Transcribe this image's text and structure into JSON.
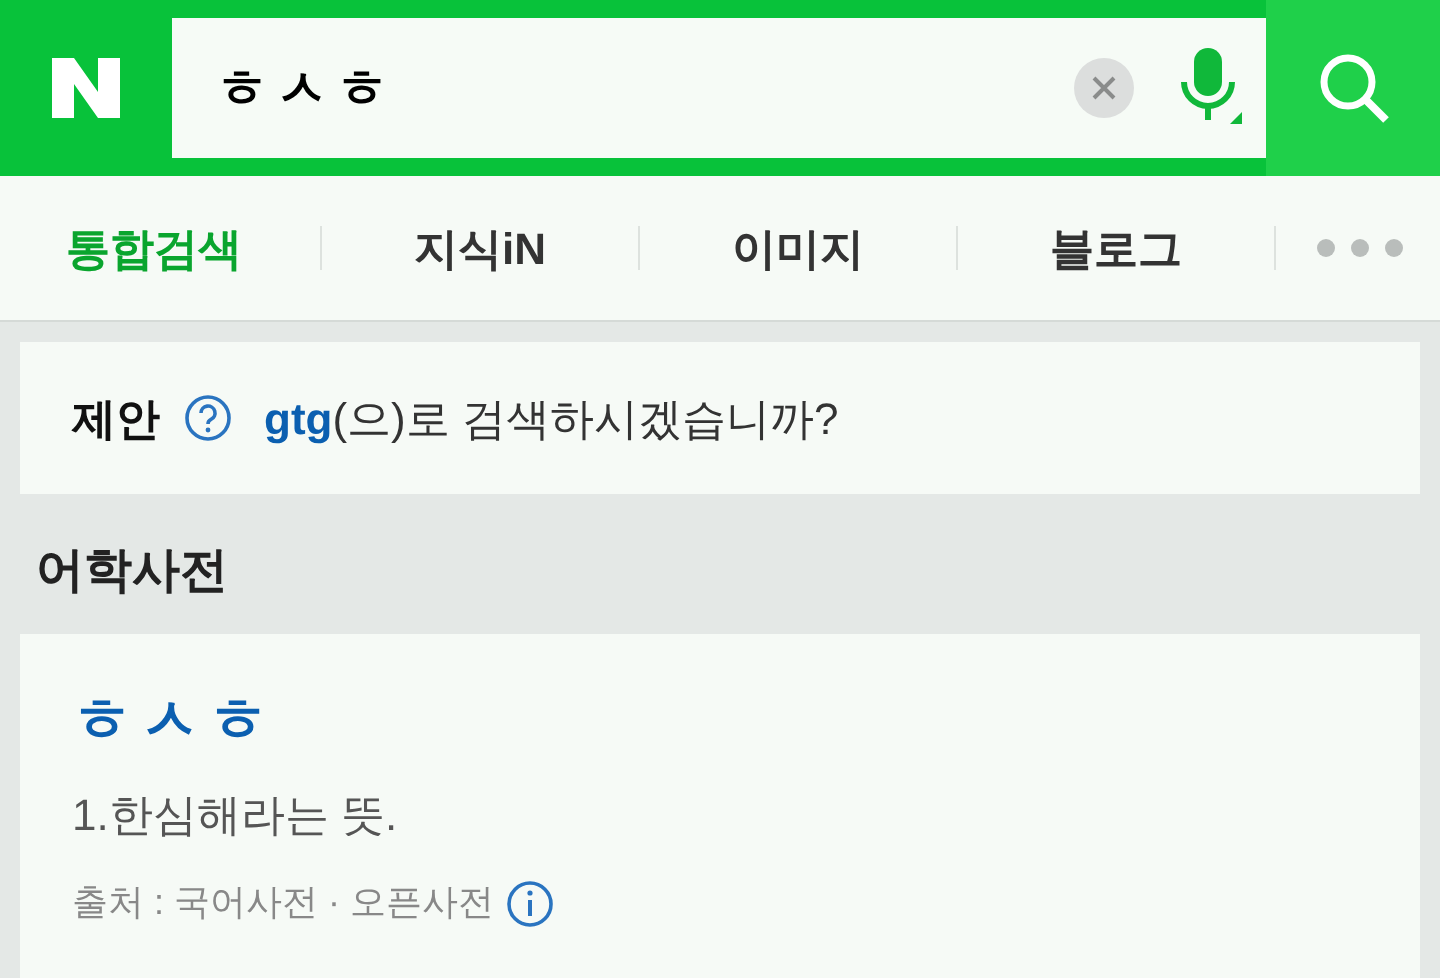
{
  "search": {
    "value": "ㅎㅅㅎ"
  },
  "tabs": [
    {
      "label": "통합검색",
      "selected": true
    },
    {
      "label": "지식iN",
      "selected": false
    },
    {
      "label": "이미지",
      "selected": false
    },
    {
      "label": "블로그",
      "selected": false
    }
  ],
  "suggestion": {
    "label": "제안",
    "link": "gtg",
    "text": "(으)로 검색하시겠습니까?"
  },
  "section": {
    "title": "어학사전"
  },
  "entry": {
    "word": "ㅎㅅㅎ",
    "meaning": "1.한심해라는 뜻.",
    "source": "출처 : 국어사전 · 오픈사전"
  }
}
